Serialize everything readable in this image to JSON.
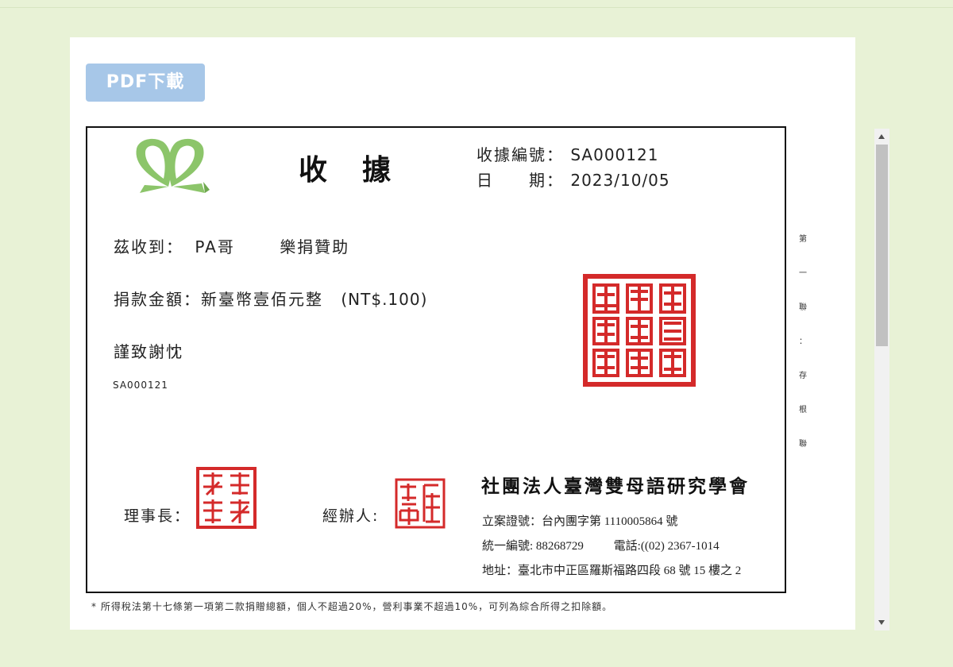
{
  "toolbar": {
    "pdf_download_label": "PDF下載"
  },
  "receipt": {
    "title": "收據",
    "number_label": "收據編號：",
    "number_value": "SA000121",
    "date_label": "日　　期：",
    "date_value": "2023/10/05",
    "received_from_label": "茲收到：",
    "donor_name": "PA哥",
    "donation_purpose": "樂捐贊助",
    "amount_label": "捐款金額：",
    "amount_text": "新臺幣壹佰元整",
    "amount_numeric": "(NT$.100)",
    "thanks": "謹致謝忱",
    "small_number": "SA000121",
    "chairman_label": "理事長：",
    "handler_label": "經辦人:",
    "org_name": "社團法人臺灣雙母語研究學會",
    "registration": "立案證號：台內團字第 1110005864 號",
    "tax_id": "統一編號: 88268729",
    "phone": "電話:((02) 2367-1014",
    "address": "地址：臺北市中正區羅斯福路四段 68 號 15 樓之 2",
    "stub_chars": [
      "第",
      "一",
      "聯",
      "：",
      "存",
      "根",
      "聯"
    ]
  },
  "footnote": "* 所得稅法第十七條第一項第二款捐贈總額，個人不超過20%，營利事業不超過10%，可列為綜合所得之扣除額。",
  "colors": {
    "page_background": "#e8f2d6",
    "button": "#a7c7e8",
    "logo_green": "#8cc56a",
    "seal_red": "#d42a2a"
  }
}
